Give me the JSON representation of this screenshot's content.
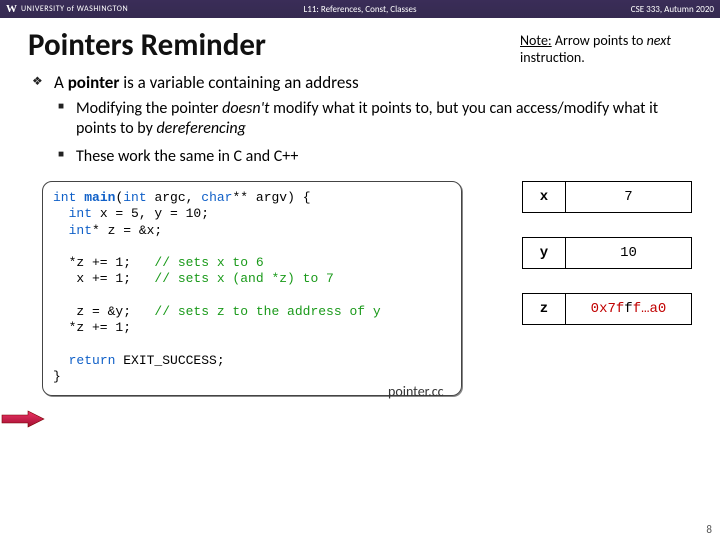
{
  "header": {
    "uw_logo": "W",
    "uw_text": "UNIVERSITY of WASHINGTON",
    "center": "L11: References, Const, Classes",
    "right": "CSE 333, Autumn 2020"
  },
  "title": "Pointers Reminder",
  "note": {
    "lead": "Note:",
    "rest1": " Arrow points to ",
    "em": "next",
    "rest2": " instruction."
  },
  "bullets": {
    "main_pre": "A ",
    "main_b": "pointer",
    "main_post": " is a variable containing an address",
    "sub1_a": "Modifying the pointer ",
    "sub1_i1": "doesn't",
    "sub1_b": " modify what it points to, but you can access/modify what it points to by ",
    "sub1_i2": "dereferencing",
    "sub2": "These work the same in C and C++"
  },
  "code": {
    "l1a": "int",
    "l1b": " ",
    "l1c": "main",
    "l1d": "(",
    "l1e": "int",
    "l1f": " argc, ",
    "l1g": "char",
    "l1h": "** argv) {",
    "l2a": "  ",
    "l2b": "int",
    "l2c": " x = 5, y = 10;",
    "l3a": "  ",
    "l3b": "int",
    "l3c": "* z = &x;",
    "blank1": "",
    "l4a": "  *z += 1;   ",
    "l4c": "// sets x to 6",
    "l5a": "   x += 1;   ",
    "l5c": "// sets x (and *z) to 7",
    "blank2": "",
    "l6a": "   z = &y;   ",
    "l6c": "// sets z to the address of y",
    "l7": "  *z += 1;",
    "blank3": "",
    "l8a": "  ",
    "l8b": "return",
    "l8c": " EXIT_SUCCESS;",
    "l9": "}"
  },
  "caption": "pointer.cc",
  "mem": {
    "x": {
      "label": "x",
      "value": "7"
    },
    "y": {
      "label": "y",
      "value": "10"
    },
    "z": {
      "label": "z",
      "val_pre": "0x7f",
      "val_mid": "f",
      "val_post": "f…a",
      "val_end": "0"
    }
  },
  "pagenum": "8"
}
